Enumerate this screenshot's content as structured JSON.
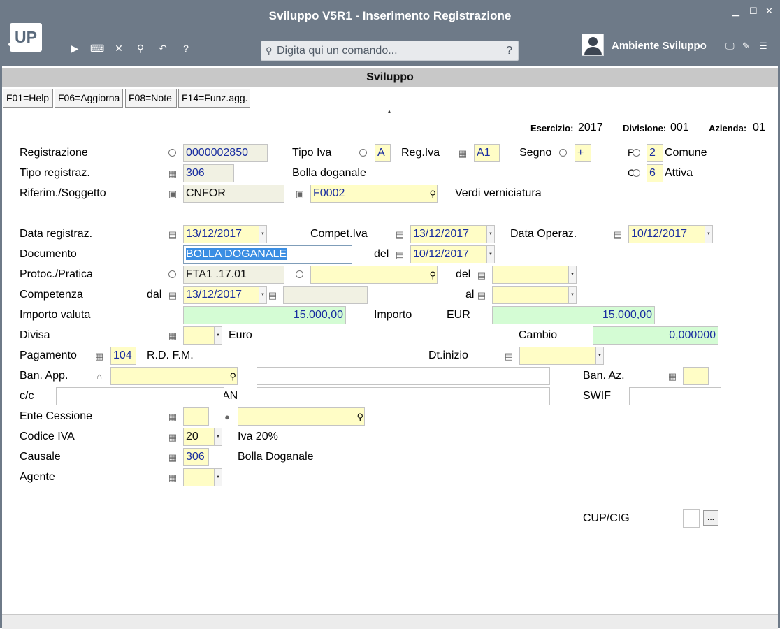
{
  "window": {
    "title": "Sviluppo V5R1 - Inserimento Registrazione",
    "logo": "UP",
    "environment": "Ambiente Sviluppo"
  },
  "toolbar": {
    "icons": [
      "play-icon",
      "terminal-icon",
      "close-icon",
      "search-icon",
      "undo-icon",
      "help-icon"
    ],
    "glyphs": [
      "▶",
      "⌨",
      "✕",
      "⚲",
      "↶",
      "?"
    ]
  },
  "command": {
    "placeholder": "Digita qui un comando...",
    "help": "?"
  },
  "subbar": {
    "title": "Sviluppo"
  },
  "fkeys": [
    {
      "label": "F01=Help"
    },
    {
      "label": "F06=Aggiorna"
    },
    {
      "label": "F08=Note"
    },
    {
      "label": "F14=Funz.agg."
    }
  ],
  "header": {
    "esercizio_label": "Esercizio:",
    "esercizio": "2017",
    "divisione_label": "Divisione:",
    "divisione": "001",
    "azienda_label": "Azienda:",
    "azienda": "01"
  },
  "form": {
    "registrazione": {
      "label": "Registrazione",
      "value": "0000002850"
    },
    "tipo_iva": {
      "label": "Tipo Iva",
      "value": "A"
    },
    "reg_iva": {
      "label": "Reg.Iva",
      "value": "A1"
    },
    "segno": {
      "label": "Segno",
      "value": "+"
    },
    "comune": {
      "prefix": "P",
      "value": "2",
      "text": "Comune"
    },
    "attiva": {
      "prefix": "C",
      "value": "6",
      "text": "Attiva"
    },
    "tipo_registraz": {
      "label": "Tipo registraz.",
      "value": "306",
      "desc": "Bolla doganale"
    },
    "riferim": {
      "label": "Riferim./Soggetto",
      "value": "CNFOR",
      "soggetto": "F0002",
      "desc": "Verdi verniciatura"
    },
    "data_registraz": {
      "label": "Data registraz.",
      "value": "13/12/2017"
    },
    "compet_iva": {
      "label": "Compet.Iva",
      "value": "13/12/2017"
    },
    "data_operaz": {
      "label": "Data Operaz.",
      "value": "10/12/2017"
    },
    "documento": {
      "label": "Documento",
      "value": "BOLLA DOGANALE",
      "del_label": "del",
      "del_value": "10/12/2017"
    },
    "protoc": {
      "label": "Protoc./Pratica",
      "value": "FTA1 .17.01",
      "del_label": "del",
      "value2": "",
      "del_value": ""
    },
    "competenza": {
      "label": "Competenza",
      "dal_label": "dal",
      "dal": "13/12/2017",
      "extra": "",
      "al_label": "al",
      "al": ""
    },
    "importo_valuta": {
      "label": "Importo valuta",
      "value": "15.000,00"
    },
    "importo": {
      "label": "Importo",
      "currency": "EUR",
      "value": "15.000,00"
    },
    "divisa": {
      "label": "Divisa",
      "value": "",
      "desc": "Euro"
    },
    "cambio": {
      "label": "Cambio",
      "value": "0,000000"
    },
    "pagamento": {
      "label": "Pagamento",
      "value": "104",
      "desc": "R.D. F.M."
    },
    "dt_inizio": {
      "label": "Dt.inizio",
      "value": ""
    },
    "ban_app": {
      "label": "Ban. App.",
      "value": "",
      "desc": ""
    },
    "ban_az": {
      "label": "Ban. Az.",
      "value": ""
    },
    "cc": {
      "label": "c/c",
      "value": "",
      "iban_label": "AN",
      "iban": ""
    },
    "swift": {
      "label": "SWIF",
      "value": ""
    },
    "ente_cessione": {
      "label": "Ente Cessione",
      "value": "",
      "soggetto": ""
    },
    "codice_iva": {
      "label": "Codice IVA",
      "value": "20",
      "desc": "Iva 20%"
    },
    "causale": {
      "label": "Causale",
      "value": "306",
      "desc": "Bolla Doganale"
    },
    "agente": {
      "label": "Agente",
      "value": ""
    },
    "cup_cig": {
      "label": "CUP/CIG",
      "value": "",
      "button": "..."
    }
  }
}
